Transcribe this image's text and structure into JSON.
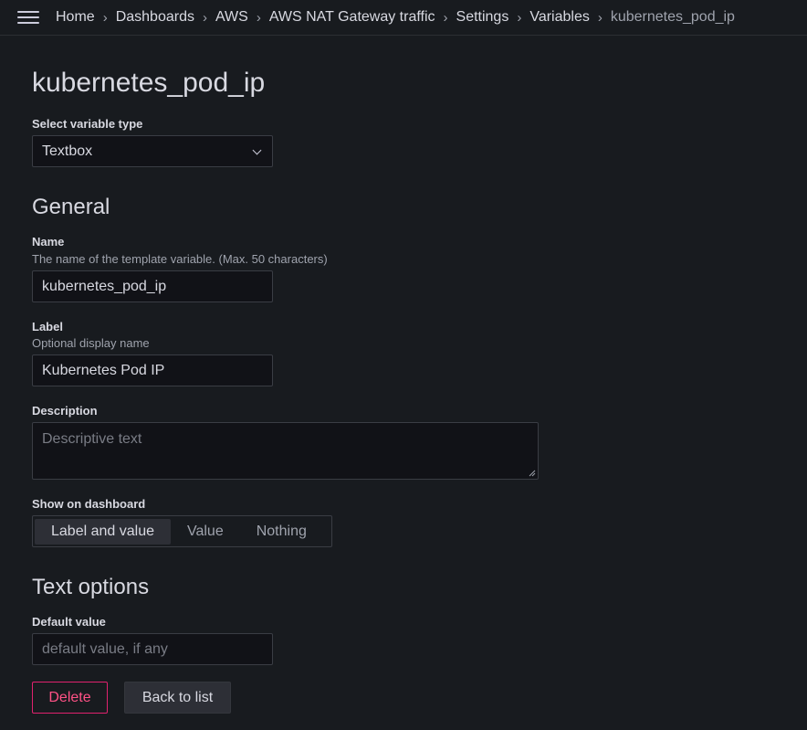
{
  "header": {
    "breadcrumbs": [
      {
        "label": "Home"
      },
      {
        "label": "Dashboards"
      },
      {
        "label": "AWS"
      },
      {
        "label": "AWS NAT Gateway traffic"
      },
      {
        "label": "Settings"
      },
      {
        "label": "Variables"
      },
      {
        "label": "kubernetes_pod_ip"
      }
    ],
    "separator": "›"
  },
  "page": {
    "title": "kubernetes_pod_ip"
  },
  "variable_type": {
    "label": "Select variable type",
    "value": "Textbox"
  },
  "general": {
    "title": "General",
    "name": {
      "label": "Name",
      "description": "The name of the template variable. (Max. 50 characters)",
      "value": "kubernetes_pod_ip"
    },
    "label_field": {
      "label": "Label",
      "description": "Optional display name",
      "value": "Kubernetes Pod IP"
    },
    "description": {
      "label": "Description",
      "placeholder": "Descriptive text"
    },
    "show_on_dashboard": {
      "label": "Show on dashboard",
      "options": [
        "Label and value",
        "Value",
        "Nothing"
      ],
      "selected": "Label and value"
    }
  },
  "text_options": {
    "title": "Text options",
    "default_value": {
      "label": "Default value",
      "placeholder": "default value, if any"
    }
  },
  "actions": {
    "delete_label": "Delete",
    "back_label": "Back to list"
  },
  "colors": {
    "background": "#181b1f",
    "input_bg": "#111217",
    "danger": "#e0226e",
    "text": "#d8d9e1"
  }
}
